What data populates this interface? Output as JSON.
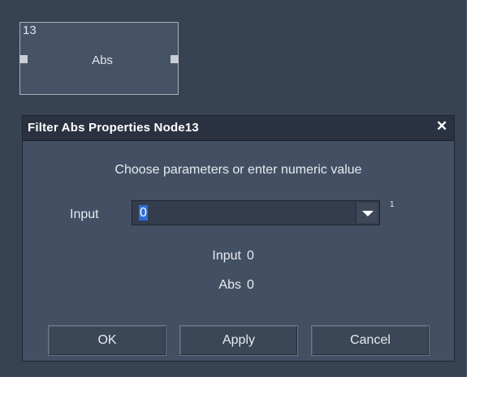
{
  "node": {
    "id": "13",
    "label": "Abs"
  },
  "dialog": {
    "title": "Filter Abs Properties Node13",
    "close_glyph": "✕",
    "prompt": "Choose parameters or enter numeric value",
    "input_field": {
      "label": "Input",
      "value": "0",
      "index_superscript": "1"
    },
    "info": [
      {
        "label": "Input",
        "value": "0"
      },
      {
        "label": "Abs",
        "value": "0"
      }
    ],
    "buttons": {
      "ok": "OK",
      "apply": "Apply",
      "cancel": "Cancel"
    }
  },
  "colors": {
    "canvas_bg": "#374253",
    "dialog_bg": "#435064",
    "titlebar_bg": "#2a3241",
    "selection": "#2f6fd6"
  }
}
